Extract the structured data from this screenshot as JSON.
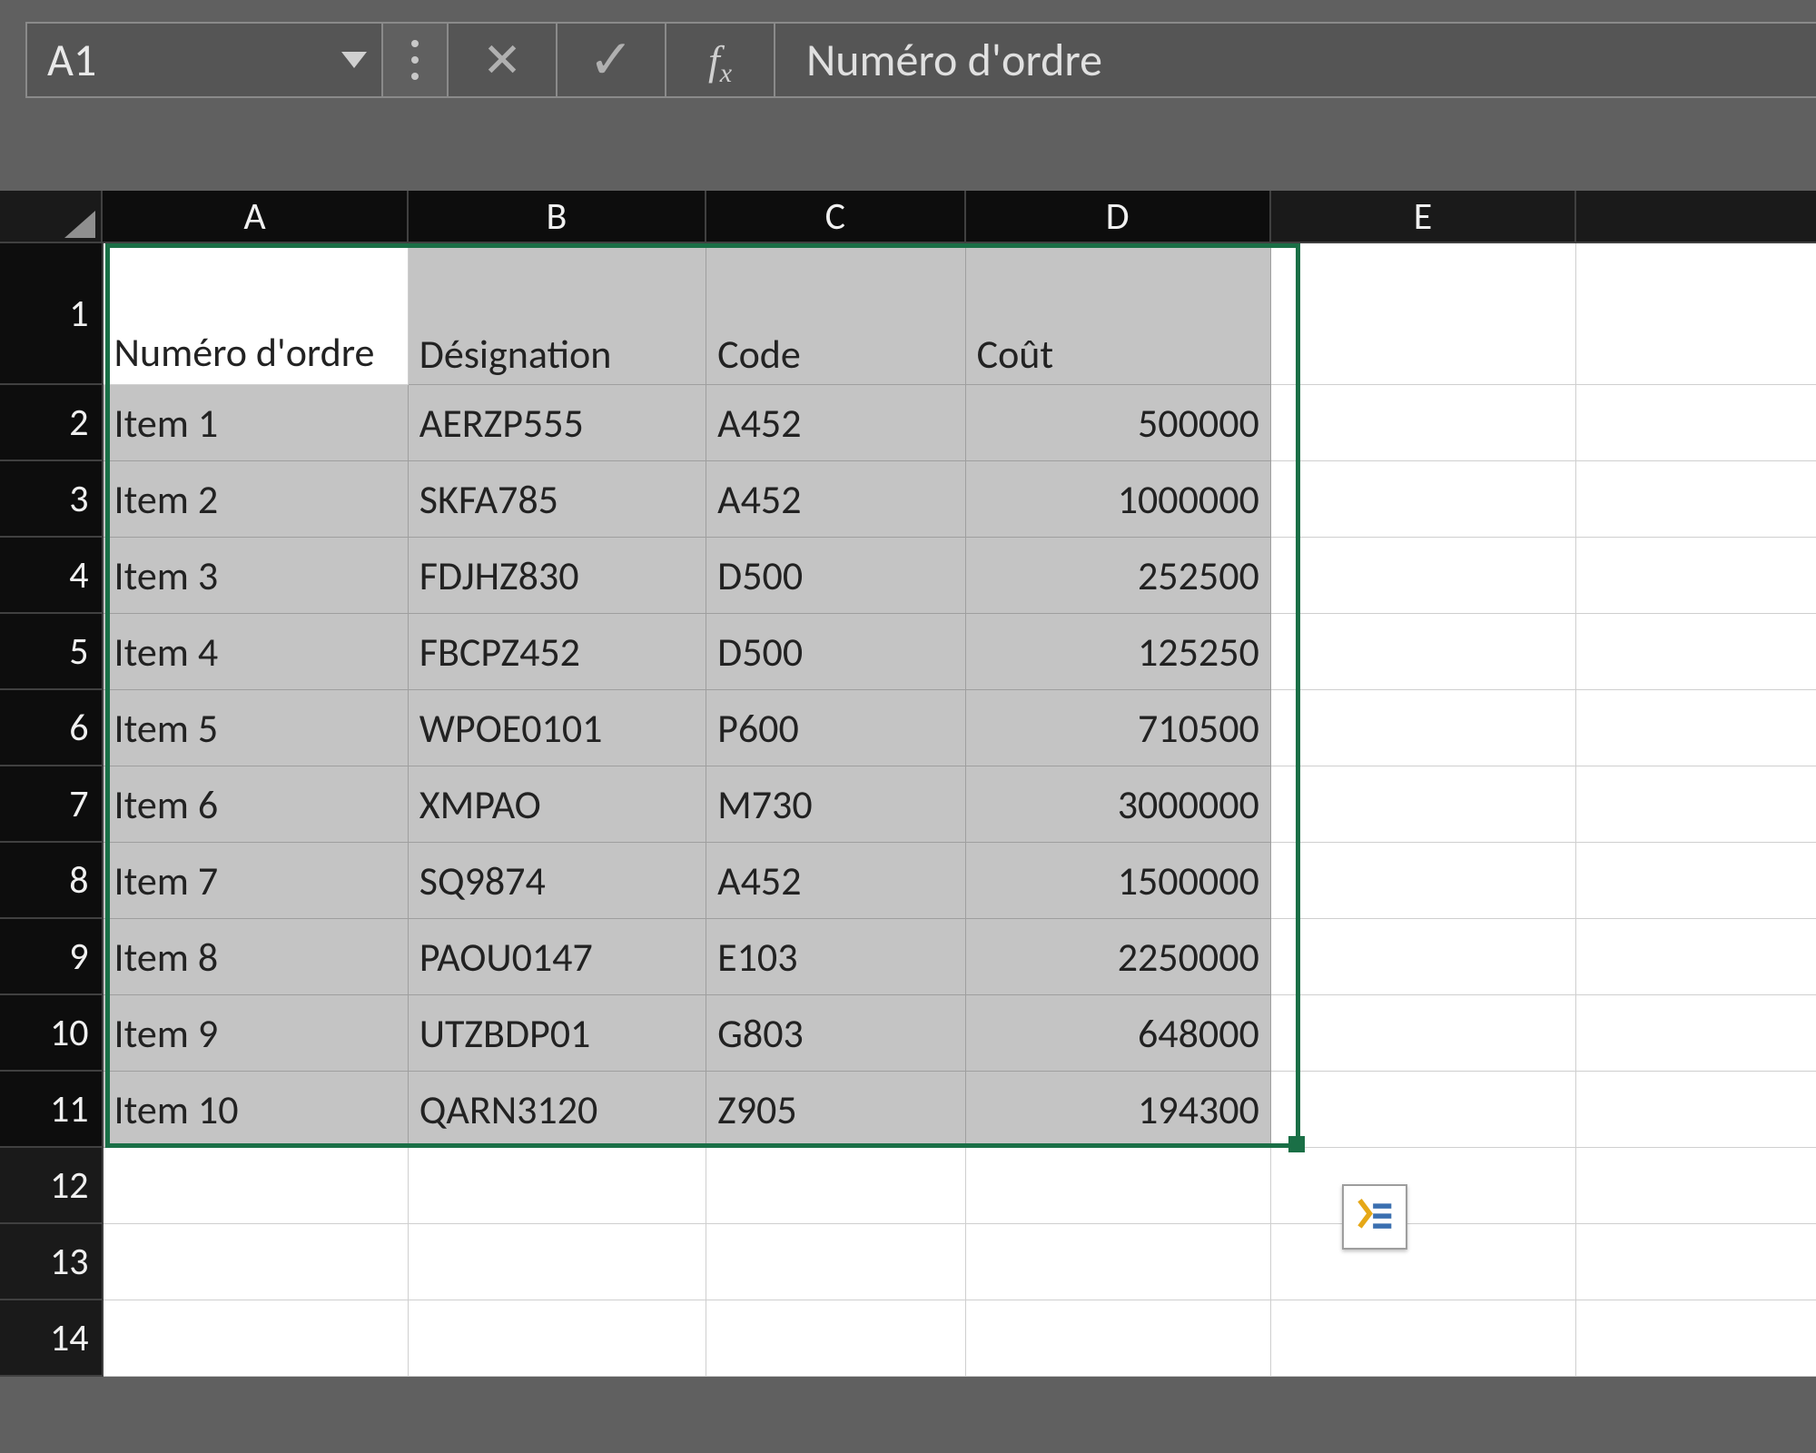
{
  "formula_bar": {
    "cell_reference": "A1",
    "formula_value": "Numéro d'ordre"
  },
  "columns": [
    "A",
    "B",
    "C",
    "D",
    "E"
  ],
  "row_numbers": [
    "1",
    "2",
    "3",
    "4",
    "5",
    "6",
    "7",
    "8",
    "9",
    "10",
    "11",
    "12",
    "13",
    "14"
  ],
  "selection": {
    "from": "A1",
    "to": "D11"
  },
  "headers": {
    "A": "Numéro d'ordre",
    "B": "Désignation",
    "C": "Code",
    "D": "Coût"
  },
  "rows": [
    {
      "A": "Item 1",
      "B": "AERZP555",
      "C": "A452",
      "D": "500000"
    },
    {
      "A": "Item 2",
      "B": "SKFA785",
      "C": "A452",
      "D": "1000000"
    },
    {
      "A": "Item 3",
      "B": "FDJHZ830",
      "C": "D500",
      "D": "252500"
    },
    {
      "A": "Item 4",
      "B": "FBCPZ452",
      "C": "D500",
      "D": "125250"
    },
    {
      "A": "Item 5",
      "B": "WPOE0101",
      "C": "P600",
      "D": "710500"
    },
    {
      "A": "Item 6",
      "B": "XMPAO",
      "C": "M730",
      "D": "3000000"
    },
    {
      "A": "Item 7",
      "B": "SQ9874",
      "C": "A452",
      "D": "1500000"
    },
    {
      "A": "Item 8",
      "B": "PAOU0147",
      "C": "E103",
      "D": "2250000"
    },
    {
      "A": "Item 9",
      "B": "UTZBDP01",
      "C": "G803",
      "D": "648000"
    },
    {
      "A": "Item 10",
      "B": "QARN3120",
      "C": "Z905",
      "D": "194300"
    }
  ]
}
